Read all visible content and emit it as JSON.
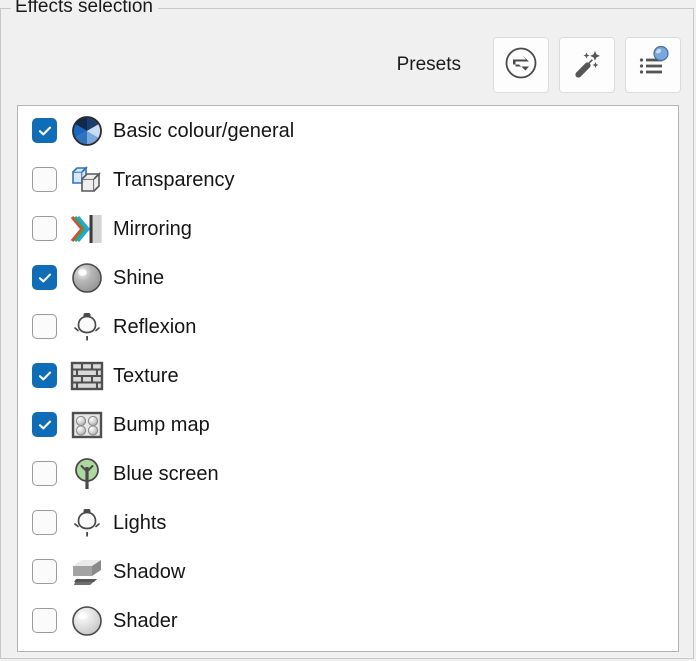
{
  "groupbox": {
    "title": "Effects selection"
  },
  "toolbar": {
    "presets_label": "Presets",
    "buttons": [
      {
        "name": "reset-presets-button",
        "icon": "swap-circle-icon",
        "label": ""
      },
      {
        "name": "auto-presets-button",
        "icon": "magic-wand-icon",
        "label": ""
      },
      {
        "name": "presets-list-button",
        "icon": "list-sphere-icon",
        "label": ""
      }
    ]
  },
  "effects_list": {
    "items": [
      {
        "label": "Basic colour/general",
        "checked": true,
        "icon": "colour-wheel-icon"
      },
      {
        "label": "Transparency",
        "checked": false,
        "icon": "transparent-cubes-icon"
      },
      {
        "label": "Mirroring",
        "checked": false,
        "icon": "mirror-chevron-icon"
      },
      {
        "label": "Shine",
        "checked": true,
        "icon": "shine-sphere-icon"
      },
      {
        "label": "Reflexion",
        "checked": false,
        "icon": "lightbulb-icon"
      },
      {
        "label": "Texture",
        "checked": true,
        "icon": "brick-wall-icon"
      },
      {
        "label": "Bump map",
        "checked": true,
        "icon": "bump-map-icon"
      },
      {
        "label": "Blue screen",
        "checked": false,
        "icon": "green-tree-icon"
      },
      {
        "label": "Lights",
        "checked": false,
        "icon": "lightbulb-icon"
      },
      {
        "label": "Shadow",
        "checked": false,
        "icon": "shadow-box-icon"
      },
      {
        "label": "Shader",
        "checked": false,
        "icon": "shader-sphere-icon"
      }
    ]
  },
  "colors": {
    "accent": "#0f6cb6",
    "window_bg": "#f0f0f0",
    "list_bg": "#ffffff",
    "text": "#151515"
  }
}
